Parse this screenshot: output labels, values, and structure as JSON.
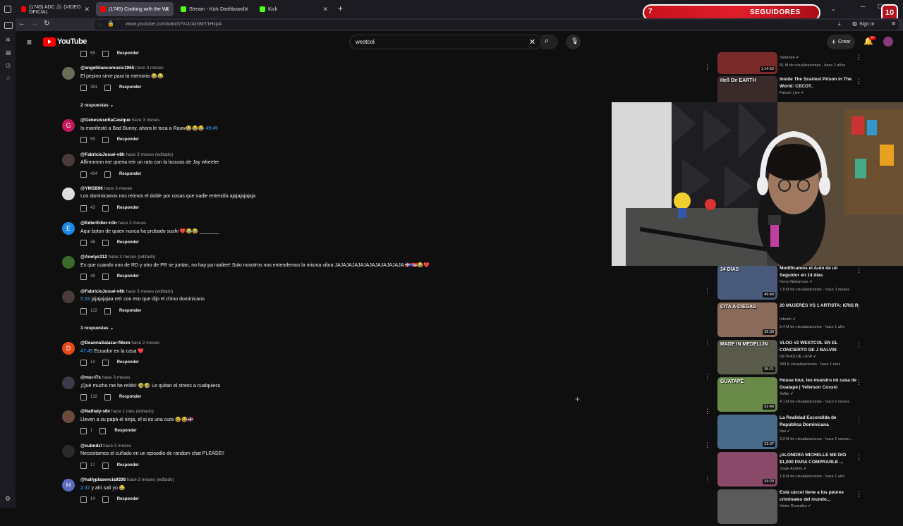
{
  "browser": {
    "tabs": [
      {
        "label": "(1745) ADC 🎥 (VIDEO OFICIAL",
        "active": false
      },
      {
        "label": "(1745) Cooking with the Whee",
        "active": true
      },
      {
        "label": "Stream - Kick Dashboard",
        "active": false
      },
      {
        "label": "Kick",
        "active": false
      }
    ],
    "url": "www.youtube.com/watch?v=U4znMY1HxpA",
    "sign_in": "Sign in"
  },
  "overlay": {
    "follower_label": "SEGUIDORES",
    "follower_left": "7",
    "follower_right": "10"
  },
  "youtube": {
    "logo_text": "YouTube",
    "search_value": "westcol",
    "create_label": "Crear",
    "notif_badge": "9+"
  },
  "comments": {
    "top_stub": {
      "likes": "65",
      "reply": "Responder"
    },
    "items": [
      {
        "user": "@angelblancomusic1965",
        "time": "hace 3 meses",
        "text": "El pepino sirve para la memoria 😂😂",
        "likes": "381",
        "reply": "Responder",
        "avatar": "",
        "avatar_color": "#6b6b5a"
      },
      {
        "user": "@GénesissofiaCasique",
        "time": "hace 3 meses",
        "text": "Is manifestó a Bad Bunny, ahora le toca a Rauw😂😂😂 ",
        "ts": "49:45",
        "likes": "55",
        "reply": "Responder",
        "avatar": "G",
        "avatar_color": "#c2185b"
      },
      {
        "user": "@FabricioJosué-v8h",
        "time": "hace 3 meses (editado)",
        "text": "Alfinnnnnn me queria reír un rato con la locuras de Jay wheeler",
        "likes": "404",
        "reply": "Responder",
        "avatar": "",
        "avatar_color": "#4a3a3a"
      },
      {
        "user": "@YMSB96",
        "time": "hace 3 meses",
        "text": "Los dominicanos nos reímos el doble por cosas que nadie  entendía ajajajajajaja",
        "likes": "43",
        "reply": "Responder",
        "avatar": "",
        "avatar_color": "#ddd"
      },
      {
        "user": "@EdierEdier-n3n",
        "time": "hace 3 meses",
        "text": "Aqui boton de quien nunca ha probado sushi ❤️😂😂 _______",
        "likes": "48",
        "reply": "Responder",
        "avatar": "E",
        "avatar_color": "#1e88e5"
      },
      {
        "user": "@Anelys312",
        "time": "hace 3 meses (editado)",
        "text": "Es que cuando uno de RD y otro de PR se juntan, no hay pa nadiee! Solo nosotros nos entendemos la misma vibra JAJAJAJAJAJAJAJAJAJAJAJA 🇩🇴🇵🇷😂❤️",
        "likes": "49",
        "reply": "Responder",
        "avatar": "",
        "avatar_color": "#3a6b2a"
      },
      {
        "user": "@FabricioJosué-v8h",
        "time": "hace 3 meses (editado)",
        "ts": "5:33",
        "text": " jajajajajaa reír con eso que dijo el chino dominicano",
        "likes": "122",
        "reply": "Responder",
        "avatar": "",
        "avatar_color": "#4a3a3a"
      },
      {
        "user": "@DeannaSalazar-fi6cm",
        "time": "hace 2 meses",
        "ts": "47:49",
        "text": " Ecuador en la casa ❤️",
        "likes": "14",
        "reply": "Responder",
        "avatar": "D",
        "avatar_color": "#e64a19"
      },
      {
        "user": "@msr-l7x",
        "time": "hace 3 meses",
        "text": "¡Qué mucho me he reído! 🤣🤣 Le quitan el stress a cualquiera",
        "likes": "132",
        "reply": "Responder",
        "avatar": "",
        "avatar_color": "#3a3a4a"
      },
      {
        "user": "@Nathaly-s6v",
        "time": "hace 1 mes (editado)",
        "text": "Lleven a su papá el ninja, el si es  una cura 😂😂🇩🇴",
        "likes": "1",
        "reply": "Responder",
        "avatar": "",
        "avatar_color": "#6a4a3a"
      },
      {
        "user": "@cubndzl",
        "time": "hace 3 meses",
        "text": "Necesitamos el cuñado en un episodio de random chat PLEASE!!",
        "likes": "17",
        "reply": "Responder",
        "avatar": "",
        "avatar_color": "#2a2a2a"
      },
      {
        "user": "@hallyplasencia9208",
        "time": "hace 3 meses (editado)",
        "ts": "2:37",
        "text": " y ahí salí yo 😂",
        "likes": "14",
        "reply": "Responder",
        "avatar": "H",
        "avatar_color": "#5c6bc0"
      }
    ],
    "replies_toggles": [
      "2 respuestas",
      "3 respuestas"
    ]
  },
  "sidebar_videos": [
    {
      "title": "",
      "channel": "Sidemen",
      "meta": "81 M de visualizaciones · hace 2 años",
      "duration": "1:14:53",
      "thumb_color": "#7a2a2a"
    },
    {
      "title": "Inside The Scariest Prison in The World: CECOT..",
      "channel": "Fanum Live",
      "meta": "",
      "duration": "",
      "thumb_color": "#3a2a2a",
      "thumb_text": "Hell On EARTH"
    },
    {
      "title": "Modificamos el Auto de un Seguidor en 14 días",
      "channel": "Kenyi Nakamura",
      "meta": "7,8 M de visualizaciones · hace 3 meses",
      "duration": "49:40",
      "thumb_color": "#4a5a7a",
      "thumb_text": "14 DÍAS"
    },
    {
      "title": "20 MUJERES VS 1 ARTISTA: KRIS R",
      "channel": "Iebriah",
      "meta": "5,4 M de visualizaciones · hace 1 año",
      "duration": "39:30",
      "thumb_color": "#8a6a5a",
      "thumb_text": "CITA A CIEGAS"
    },
    {
      "title": "VLOG #2 WESTCOL EN EL CONCIERTO DE J BALVIN",
      "channel": "DETRAS DE LA W",
      "meta": "390 K visualizaciones · hace 1 mes",
      "duration": "35:21",
      "thumb_color": "#5a5a4a",
      "thumb_text": "MADE IN MEDELLÍN"
    },
    {
      "title": "House tour, les muestro mi casa de Guatapé | Yeferson Cossio",
      "channel": "Yefito",
      "meta": "4,1 M de visualizaciones · hace 5 meses",
      "duration": "52:40",
      "thumb_color": "#6a8a4a",
      "thumb_text": "GUATAPÉ"
    },
    {
      "title": "La Realidad Escondida de República Dominicana",
      "channel": "Ibai",
      "meta": "3,3 M de visualizaciones · hace 2 seman...",
      "duration": "23:37",
      "thumb_color": "#4a6a8a"
    },
    {
      "title": "¡ALONDRA MICHELLE ME DIO $1,000 PARA COMPRARLE ...",
      "channel": "Jorge Andrés",
      "meta": "1,8 M de visualizaciones · hace 1 año",
      "duration": "34:20",
      "thumb_color": "#8a4a6a"
    },
    {
      "title": "Está cárcel tiene a los peores criminales del mundo...",
      "channel": "Victor Gonzáles",
      "meta": "",
      "duration": "",
      "thumb_color": "#5a5a5a"
    }
  ]
}
